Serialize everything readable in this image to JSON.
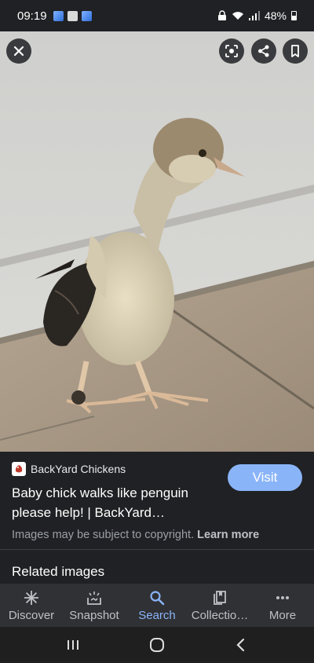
{
  "status": {
    "time": "09:19",
    "battery": "48%"
  },
  "viewer": {
    "close_icon": "close-icon",
    "lens_icon": "lens-icon",
    "share_icon": "share-icon",
    "save_icon": "bookmark-icon"
  },
  "info": {
    "source_name": "BackYard Chickens",
    "visit_label": "Visit",
    "title": "Baby chick walks like penguin please help! | BackYard…",
    "copyright_text": "Images may be subject to copyright.",
    "learn_more": "Learn more",
    "related_heading": "Related images"
  },
  "nav": {
    "items": [
      {
        "label": "Discover",
        "icon": "asterisk-icon"
      },
      {
        "label": "Snapshot",
        "icon": "snapshot-icon"
      },
      {
        "label": "Search",
        "icon": "search-icon"
      },
      {
        "label": "Collectio…",
        "icon": "collections-icon"
      },
      {
        "label": "More",
        "icon": "more-icon"
      }
    ]
  },
  "colors": {
    "accent": "#8ab4f8",
    "background": "#202124"
  }
}
